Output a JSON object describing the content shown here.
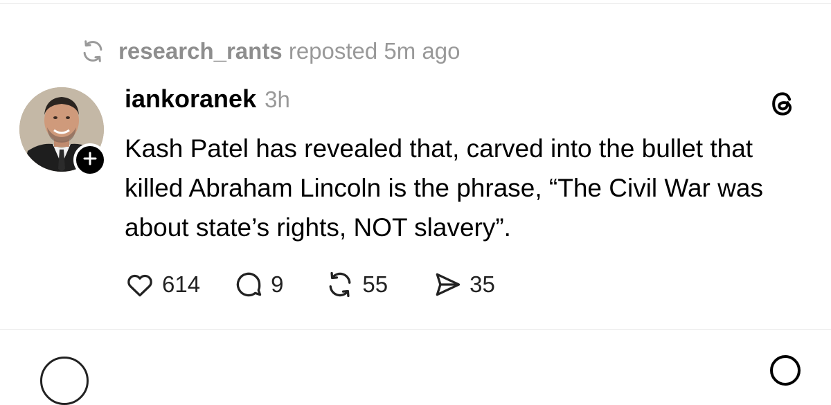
{
  "repost": {
    "user": "research_rants",
    "text": "reposted 5m ago",
    "icon": "repost-icon"
  },
  "post": {
    "author": "iankoranek",
    "time": "3h",
    "body": "Kash Patel has revealed that, carved into the bullet that killed Abraham Lincoln is the phrase, “The Civil War was about state’s rights, NOT slavery”.",
    "avatar_icon": "avatar",
    "follow_icon": "plus-icon",
    "brand_icon": "threads-icon"
  },
  "actions": {
    "likes": "614",
    "replies": "9",
    "reposts": "55",
    "shares": "35"
  },
  "colors": {
    "muted_text": "#999999",
    "text": "#000000",
    "divider": "#e6e6e6"
  }
}
